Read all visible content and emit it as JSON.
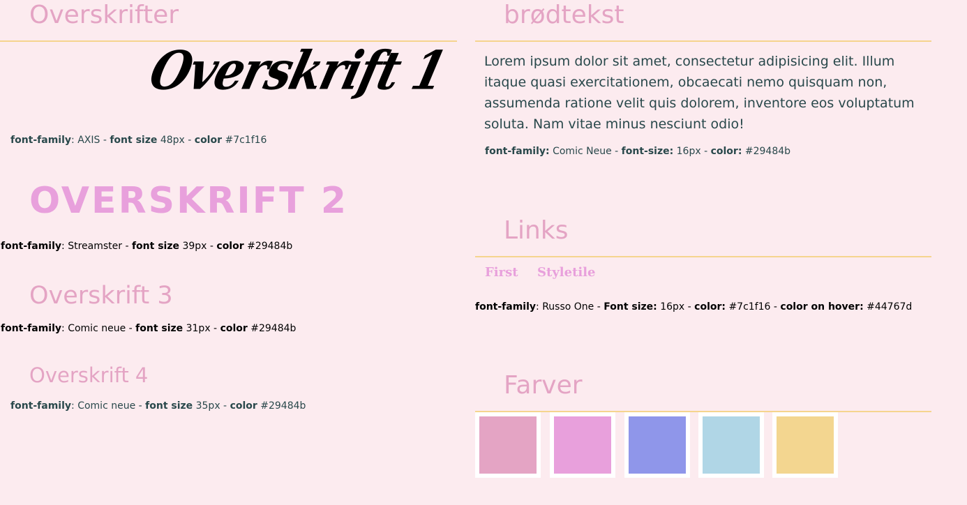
{
  "left": {
    "heading": "Overskrifter",
    "h1": {
      "sample": "Overskrift 1",
      "spec": {
        "k1": "font-family",
        "v1": ": AXIS - ",
        "k2": "font size",
        "v2": " 48px - ",
        "k3": "color",
        "v3": " #7c1f16"
      }
    },
    "h2": {
      "sample": "Overskrift 2",
      "spec": {
        "k1": "font-family",
        "v1": ": Streamster - ",
        "k2": "font size",
        "v2": " 39px - ",
        "k3": "color",
        "v3": " #29484b"
      }
    },
    "h3": {
      "sample": "Overskrift 3",
      "spec": {
        "k1": "font-family",
        "v1": ": Comic neue - ",
        "k2": "font size",
        "v2": " 31px - ",
        "k3": "color",
        "v3": " #29484b"
      }
    },
    "h4": {
      "sample": "Overskrift 4",
      "spec": {
        "k1": "font-family",
        "v1": ": Comic neue - ",
        "k2": "font size",
        "v2": " 35px - ",
        "k3": "color",
        "v3": " #29484b"
      }
    }
  },
  "right": {
    "body_heading": "brødtekst",
    "body_text": "Lorem ipsum dolor sit amet, consectetur adipisicing elit. Illum itaque quasi exercitationem, obcaecati nemo quisquam non, assumenda ratione velit quis dolorem, inventore eos voluptatum soluta. Nam vitae minus nesciunt odio!",
    "body_spec": {
      "k1": "font-family:",
      "v1": " Comic Neue - ",
      "k2": "font-size:",
      "v2": " 16px - ",
      "k3": "color:",
      "v3": " #29484b"
    },
    "links_heading": "Links",
    "links": [
      "First",
      "Styletile"
    ],
    "links_spec": {
      "k1": "font-family",
      "v1": ": Russo One - ",
      "k2": "Font size:",
      "v2": " 16px - ",
      "k3": "color:",
      "v3": " #7c1f16 - ",
      "k4": "color on hover:",
      "v4": " #44767d"
    },
    "colors_heading": "Farver",
    "swatches": [
      "#e4a4c4",
      "#e8a0dc",
      "#8f96ea",
      "#b0d6e6",
      "#f3d690"
    ]
  }
}
